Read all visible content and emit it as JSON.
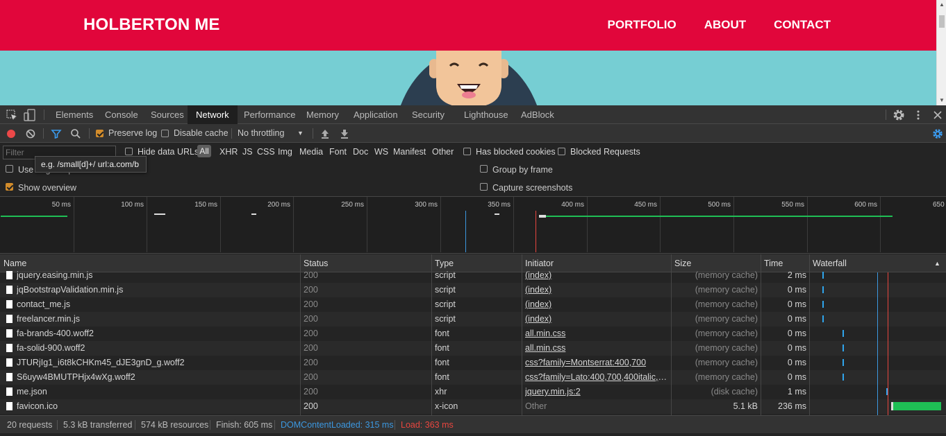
{
  "site": {
    "brand": "HOLBERTON ME",
    "nav": [
      "PORTFOLIO",
      "ABOUT",
      "CONTACT"
    ]
  },
  "devtools": {
    "tabs": [
      "Elements",
      "Console",
      "Sources",
      "Network",
      "Performance",
      "Memory",
      "Application",
      "Security",
      "Lighthouse",
      "AdBlock"
    ],
    "active_tab": "Network",
    "toolbar": {
      "preserve_log": "Preserve log",
      "disable_cache": "Disable cache",
      "throttling": "No throttling"
    },
    "filter": {
      "placeholder": "Filter",
      "hide_data_urls": "Hide data URLs",
      "all": "All",
      "types": [
        "XHR",
        "JS",
        "CSS",
        "Img",
        "Media",
        "Font",
        "Doc",
        "WS",
        "Manifest",
        "Other"
      ],
      "has_blocked_cookies": "Has blocked cookies",
      "blocked_requests": "Blocked Requests",
      "tooltip": "e.g. /small[d]+/ url:a.com/b"
    },
    "settings": {
      "use_large_rows": "Use large request rows",
      "show_overview": "Show overview",
      "group_by_frame": "Group by frame",
      "capture_screenshots": "Capture screenshots"
    },
    "overview_ticks": [
      "50 ms",
      "100 ms",
      "150 ms",
      "200 ms",
      "250 ms",
      "300 ms",
      "350 ms",
      "400 ms",
      "450 ms",
      "500 ms",
      "550 ms",
      "600 ms",
      "650 ms"
    ],
    "columns": [
      "Name",
      "Status",
      "Type",
      "Initiator",
      "Size",
      "Time",
      "Waterfall"
    ],
    "rows": [
      {
        "name": "jquery.easing.min.js",
        "status": "200",
        "type": "script",
        "initiator": "(index)",
        "size": "(memory cache)",
        "time": "2 ms",
        "wf": 0.09
      },
      {
        "name": "jqBootstrapValidation.min.js",
        "status": "200",
        "type": "script",
        "initiator": "(index)",
        "size": "(memory cache)",
        "time": "0 ms",
        "wf": 0.09
      },
      {
        "name": "contact_me.js",
        "status": "200",
        "type": "script",
        "initiator": "(index)",
        "size": "(memory cache)",
        "time": "0 ms",
        "wf": 0.09
      },
      {
        "name": "freelancer.min.js",
        "status": "200",
        "type": "script",
        "initiator": "(index)",
        "size": "(memory cache)",
        "time": "0 ms",
        "wf": 0.09
      },
      {
        "name": "fa-brands-400.woff2",
        "status": "200",
        "type": "font",
        "initiator": "all.min.css",
        "size": "(memory cache)",
        "time": "0 ms",
        "wf": 0.24
      },
      {
        "name": "fa-solid-900.woff2",
        "status": "200",
        "type": "font",
        "initiator": "all.min.css",
        "size": "(memory cache)",
        "time": "0 ms",
        "wf": 0.24
      },
      {
        "name": "JTURjIg1_i6t8kCHKm45_dJE3gnD_g.woff2",
        "status": "200",
        "type": "font",
        "initiator": "css?family=Montserrat:400,700",
        "size": "(memory cache)",
        "time": "0 ms",
        "wf": 0.24
      },
      {
        "name": "S6uyw4BMUTPHjx4wXg.woff2",
        "status": "200",
        "type": "font",
        "initiator": "css?family=Lato:400,700,400italic,700...",
        "size": "(memory cache)",
        "time": "0 ms",
        "wf": 0.24
      },
      {
        "name": "me.json",
        "status": "200",
        "type": "xhr",
        "initiator": "jquery.min.js:2",
        "size": "(disk cache)",
        "time": "1 ms",
        "wf": 0.56
      },
      {
        "name": "favicon.ico",
        "status": "200",
        "type": "x-icon",
        "initiator": "Other",
        "size": "5.1 kB",
        "time": "236 ms",
        "wf": 0.6
      }
    ],
    "status_bar": {
      "requests": "20 requests",
      "transferred": "5.3 kB transferred",
      "resources": "574 kB resources",
      "finish": "Finish: 605 ms",
      "dom_content_loaded": "DOMContentLoaded: 315 ms",
      "load": "Load: 363 ms"
    },
    "colors": {
      "dcl": "#3c98e0",
      "load": "#e8463f",
      "brand": "#e1063b",
      "hero": "#76ced3"
    }
  }
}
